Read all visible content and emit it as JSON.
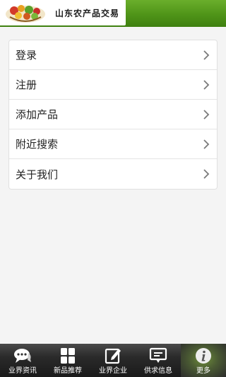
{
  "header": {
    "title": "山东农产品交易"
  },
  "menu": {
    "items": [
      {
        "label": "登录"
      },
      {
        "label": "注册"
      },
      {
        "label": "添加产品"
      },
      {
        "label": "附近搜索"
      },
      {
        "label": "关于我们"
      }
    ]
  },
  "bottom_nav": {
    "items": [
      {
        "label": "业界资讯",
        "icon": "chat-bubbles-icon"
      },
      {
        "label": "新品推荐",
        "icon": "grid-icon"
      },
      {
        "label": "业界企业",
        "icon": "edit-icon"
      },
      {
        "label": "供求信息",
        "icon": "message-icon"
      },
      {
        "label": "更多",
        "icon": "info-icon",
        "active": true
      }
    ]
  },
  "colors": {
    "header_green": "#4f9418",
    "nav_bg": "#2a2a2a",
    "active_tab": "#6e8d3a"
  }
}
